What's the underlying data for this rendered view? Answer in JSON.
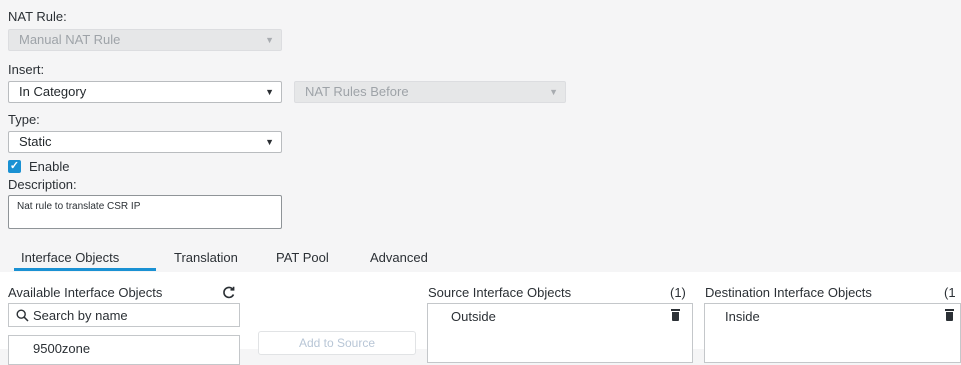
{
  "nat_rule": {
    "label": "NAT Rule:",
    "value": "Manual NAT Rule"
  },
  "insert": {
    "label": "Insert:",
    "value": "In Category",
    "secondary_value": "NAT Rules Before"
  },
  "type": {
    "label": "Type:",
    "value": "Static"
  },
  "enable": {
    "label": "Enable",
    "checked": true
  },
  "description": {
    "label": "Description:",
    "value": "Nat rule to translate CSR IP"
  },
  "tabs": [
    {
      "label": "Interface Objects",
      "active": true
    },
    {
      "label": "Translation"
    },
    {
      "label": "PAT Pool"
    },
    {
      "label": "Advanced"
    }
  ],
  "available": {
    "header": "Available Interface Objects",
    "search_placeholder": "Search by name",
    "items": [
      "9500zone"
    ],
    "add_button": "Add to Source"
  },
  "source": {
    "header": "Source Interface Objects",
    "count": "(1)",
    "items": [
      "Outside"
    ]
  },
  "destination": {
    "header": "Destination Interface Objects",
    "count": "(1",
    "items": [
      "Inside"
    ]
  },
  "colors": {
    "accent": "#1a91d3",
    "background": "#f5f5f6"
  }
}
